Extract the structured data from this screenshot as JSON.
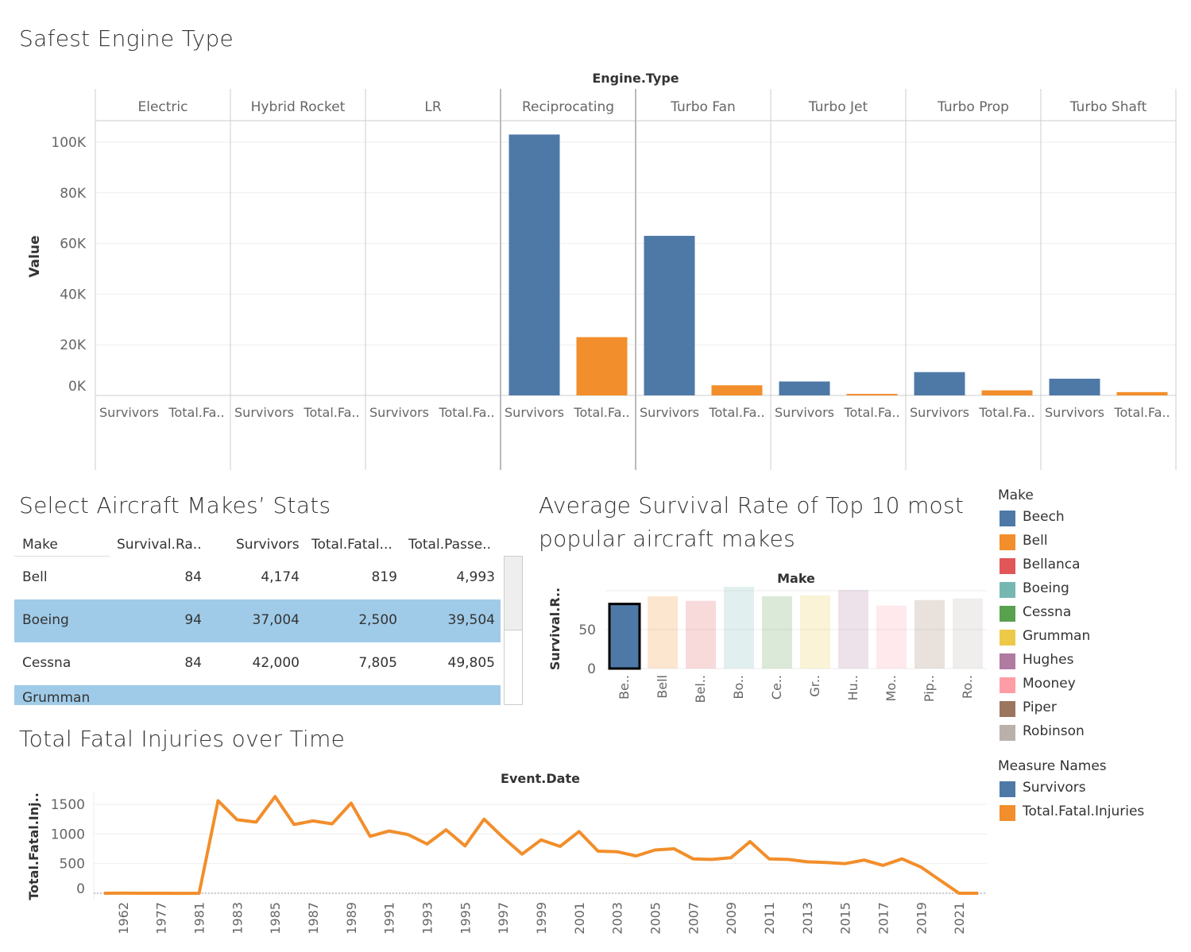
{
  "titles": {
    "engine": "Safest Engine Type",
    "table": "Select Aircraft Makes’ Stats",
    "survival_line1": "Average Survival Rate of Top 10 most",
    "survival_line2": "popular aircraft makes",
    "fatal": "Total Fatal Injuries over Time"
  },
  "colors": {
    "survivors": "#4e79a7",
    "fatal": "#f28e2b",
    "selected_row": "#a0cbe8"
  },
  "table": {
    "columns": [
      "Make",
      "Survival.Ra..",
      "Survivors",
      "Total.Fatal...",
      "Total.Passe.."
    ],
    "rows": [
      {
        "make": "Bell",
        "rate": "84",
        "survivors": "4,174",
        "fatal": "819",
        "passengers": "4,993",
        "selected": false
      },
      {
        "make": "Boeing",
        "rate": "94",
        "survivors": "37,004",
        "fatal": "2,500",
        "passengers": "39,504",
        "selected": true
      },
      {
        "make": "Cessna",
        "rate": "84",
        "survivors": "42,000",
        "fatal": "7,805",
        "passengers": "49,805",
        "selected": false
      },
      {
        "make": "Grumman",
        "rate": "",
        "survivors": "",
        "fatal": "",
        "passengers": "",
        "selected": true
      }
    ]
  },
  "legend_make": {
    "title": "Make",
    "items": [
      {
        "label": "Beech",
        "color": "#4e79a7"
      },
      {
        "label": "Bell",
        "color": "#f28e2b"
      },
      {
        "label": "Bellanca",
        "color": "#e15759"
      },
      {
        "label": "Boeing",
        "color": "#76b7b2"
      },
      {
        "label": "Cessna",
        "color": "#59a14f"
      },
      {
        "label": "Grumman",
        "color": "#edc948"
      },
      {
        "label": "Hughes",
        "color": "#b07aa1"
      },
      {
        "label": "Mooney",
        "color": "#ff9da7"
      },
      {
        "label": "Piper",
        "color": "#9c755f"
      },
      {
        "label": "Robinson",
        "color": "#bab0ac"
      }
    ]
  },
  "legend_measure": {
    "title": "Measure Names",
    "items": [
      {
        "label": "Survivors",
        "color": "#4e79a7"
      },
      {
        "label": "Total.Fatal.Injuries",
        "color": "#f28e2b"
      }
    ]
  },
  "chart_data": [
    {
      "type": "bar",
      "title": "Safest Engine Type",
      "column_header": "Engine.Type",
      "ylabel": "Value",
      "ylim": [
        0,
        110000
      ],
      "yticks": [
        0,
        20000,
        40000,
        60000,
        80000,
        100000
      ],
      "ytick_labels": [
        "0K",
        "20K",
        "40K",
        "60K",
        "80K",
        "100K"
      ],
      "categories": [
        "Electric",
        "Hybrid Rocket",
        "LR",
        "Reciprocating",
        "Turbo Fan",
        "Turbo Jet",
        "Turbo Prop",
        "Turbo Shaft"
      ],
      "sub_labels": [
        "Survivors",
        "Total.Fa.."
      ],
      "series": [
        {
          "name": "Survivors",
          "values": [
            0,
            0,
            0,
            103000,
            63000,
            5500,
            9200,
            6600
          ]
        },
        {
          "name": "Total.Fatal.Injuries",
          "values": [
            0,
            0,
            0,
            23000,
            4000,
            600,
            2000,
            1300
          ]
        }
      ],
      "grid": true
    },
    {
      "type": "bar",
      "title": "Average Survival Rate of Top 10 most popular aircraft makes",
      "column_header": "Make",
      "ylabel": "Survival.R..",
      "ylim": [
        0,
        110
      ],
      "yticks": [
        0,
        50
      ],
      "categories": [
        "Be..",
        "Bell",
        "Bel..",
        "Bo..",
        "Ce..",
        "Gr..",
        "Hu..",
        "Mo..",
        "Pip..",
        "Ro.."
      ],
      "values": [
        83,
        93,
        87,
        105,
        93,
        94,
        101,
        81,
        88,
        90
      ],
      "highlighted": "Be..",
      "grid": true
    },
    {
      "type": "line",
      "title": "Total Fatal Injuries over Time",
      "column_header": "Event.Date",
      "ylabel": "Total.Fatal.Inj..",
      "ylim": [
        -100,
        1800
      ],
      "yticks": [
        0,
        500,
        1000,
        1500
      ],
      "x_tick_labels": [
        "1962",
        "1977",
        "1981",
        "1983",
        "1985",
        "1987",
        "1989",
        "1991",
        "1993",
        "1995",
        "1997",
        "1999",
        "2001",
        "2003",
        "2005",
        "2007",
        "2009",
        "2011",
        "2013",
        "2015",
        "2017",
        "2019",
        "2021"
      ],
      "x": [
        "1948",
        "1962",
        "1974",
        "1977",
        "1979",
        "1981",
        "1982",
        "1983",
        "1984",
        "1985",
        "1986",
        "1987",
        "1988",
        "1989",
        "1990",
        "1991",
        "1992",
        "1993",
        "1994",
        "1995",
        "1996",
        "1997",
        "1998",
        "1999",
        "2000",
        "2001",
        "2002",
        "2003",
        "2004",
        "2005",
        "2006",
        "2007",
        "2008",
        "2009",
        "2010",
        "2011",
        "2012",
        "2013",
        "2014",
        "2015",
        "2016",
        "2017",
        "2018",
        "2019",
        "2020",
        "2021",
        "2022"
      ],
      "values": [
        0,
        2,
        0,
        0,
        -2,
        0,
        1560,
        1240,
        1200,
        1630,
        1160,
        1220,
        1170,
        1520,
        960,
        1050,
        990,
        830,
        1070,
        800,
        1250,
        940,
        660,
        900,
        790,
        1040,
        710,
        700,
        630,
        730,
        750,
        580,
        570,
        600,
        870,
        580,
        570,
        530,
        520,
        500,
        560,
        470,
        580,
        440,
        220,
        0,
        0
      ],
      "grid": true
    }
  ]
}
